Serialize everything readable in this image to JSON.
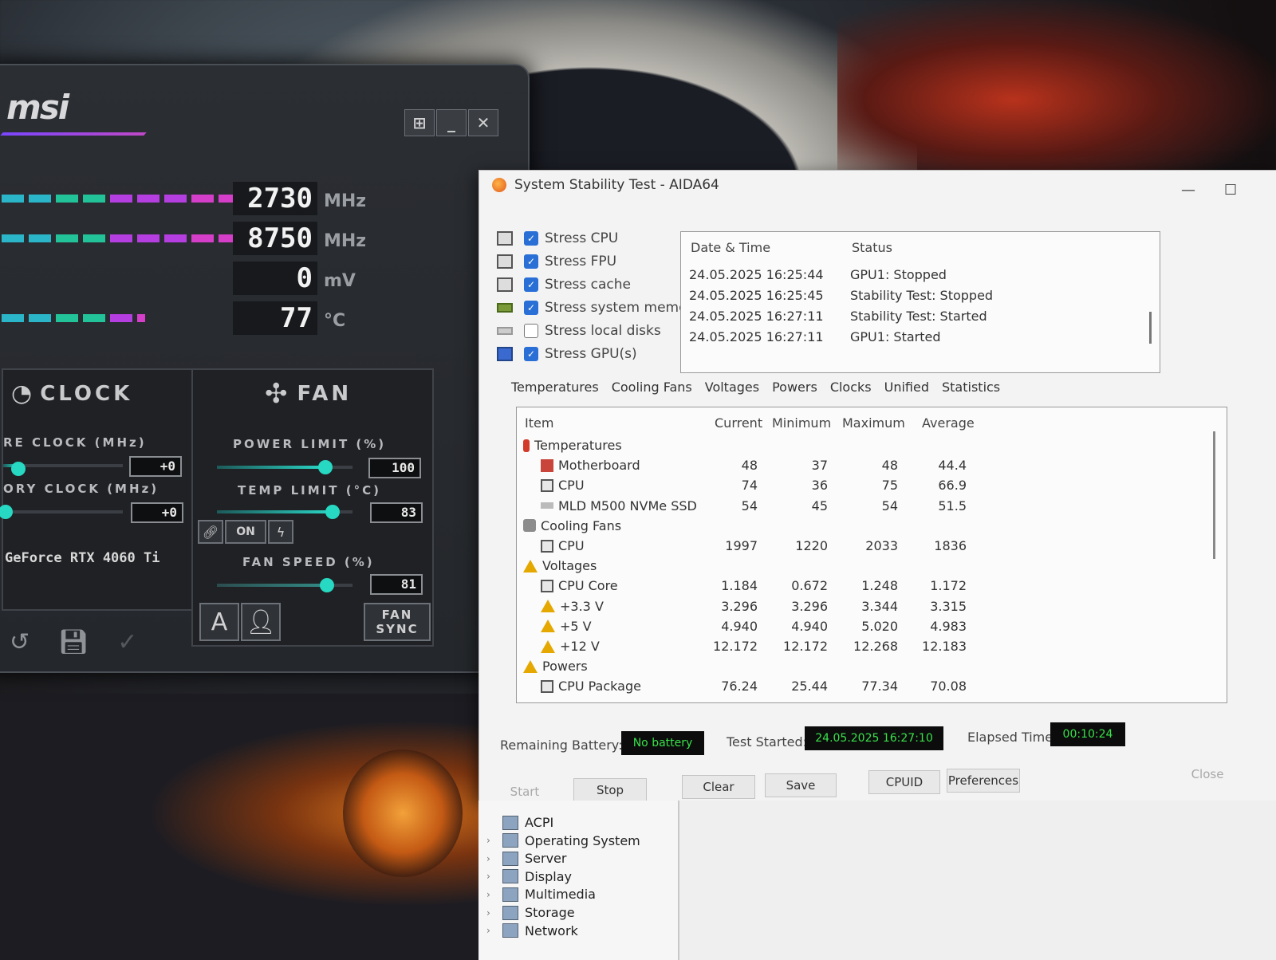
{
  "msi": {
    "logo": "msi",
    "readouts": [
      {
        "value": "2730",
        "unit": "MHz"
      },
      {
        "value": "8750",
        "unit": "MHz"
      },
      {
        "value": "0",
        "unit": "mV"
      },
      {
        "value": "77",
        "unit": "°C"
      }
    ],
    "clock_head": "CLOCK",
    "fan_head": "FAN",
    "core_clock_label": "RE CLOCK (MHz)",
    "core_clock_value": "+0",
    "memory_clock_label": "ORY CLOCK (MHz)",
    "memory_clock_value": "+0",
    "power_limit_label": "POWER LIMIT (%)",
    "power_limit_value": "100",
    "power_limit_level": 0.8,
    "temp_limit_label": "TEMP LIMIT (°C)",
    "temp_limit_value": "83",
    "temp_limit_level": 0.85,
    "link_toggle": "ON",
    "fan_speed_label": "FAN SPEED (%)",
    "fan_speed_value": "81",
    "fan_speed_level": 0.81,
    "gpu_name": "GeForce RTX 4060 Ti",
    "fan_sync": "FAN SYNC",
    "auto_label": "A"
  },
  "aida": {
    "title": "System Stability Test - AIDA64",
    "stress": [
      {
        "label": "Stress CPU",
        "checked": true
      },
      {
        "label": "Stress FPU",
        "checked": true
      },
      {
        "label": "Stress cache",
        "checked": true
      },
      {
        "label": "Stress system memory",
        "checked": true
      },
      {
        "label": "Stress local disks",
        "checked": false
      },
      {
        "label": "Stress GPU(s)",
        "checked": true
      }
    ],
    "log": {
      "col_date": "Date & Time",
      "col_status": "Status",
      "rows": [
        {
          "date": "24.05.2025 16:25:44",
          "status": "GPU1: Stopped"
        },
        {
          "date": "24.05.2025 16:25:45",
          "status": "Stability Test: Stopped"
        },
        {
          "date": "24.05.2025 16:27:11",
          "status": "Stability Test: Started"
        },
        {
          "date": "24.05.2025 16:27:11",
          "status": "GPU1: Started"
        }
      ]
    },
    "tabs": [
      "Temperatures",
      "Cooling Fans",
      "Voltages",
      "Powers",
      "Clocks",
      "Unified",
      "Statistics"
    ],
    "grid": {
      "cols": [
        "Item",
        "Current",
        "Minimum",
        "Maximum",
        "Average"
      ],
      "rows": [
        {
          "name": "Temperatures",
          "icon": "thermometer-icon",
          "group": true
        },
        {
          "name": "Motherboard",
          "icon": "motherboard-icon",
          "cur": "48",
          "min": "37",
          "max": "48",
          "avg": "44.4"
        },
        {
          "name": "CPU",
          "icon": "chip-icon",
          "cur": "74",
          "min": "36",
          "max": "75",
          "avg": "66.9"
        },
        {
          "name": "MLD M500 NVMe SSD",
          "icon": "ssd-icon",
          "cur": "54",
          "min": "45",
          "max": "54",
          "avg": "51.5"
        },
        {
          "name": "Cooling Fans",
          "icon": "fan-icon",
          "group": true
        },
        {
          "name": "CPU",
          "icon": "chip-icon",
          "cur": "1997",
          "min": "1220",
          "max": "2033",
          "avg": "1836"
        },
        {
          "name": "Voltages",
          "icon": "warning-icon",
          "group": true
        },
        {
          "name": "CPU Core",
          "icon": "chip-icon",
          "cur": "1.184",
          "min": "0.672",
          "max": "1.248",
          "avg": "1.172"
        },
        {
          "name": "+3.3 V",
          "icon": "warning-icon",
          "cur": "3.296",
          "min": "3.296",
          "max": "3.344",
          "avg": "3.315"
        },
        {
          "name": "+5 V",
          "icon": "warning-icon",
          "cur": "4.940",
          "min": "4.940",
          "max": "5.020",
          "avg": "4.983"
        },
        {
          "name": "+12 V",
          "icon": "warning-icon",
          "cur": "12.172",
          "min": "12.172",
          "max": "12.268",
          "avg": "12.183"
        },
        {
          "name": "Powers",
          "icon": "warning-icon",
          "group": true
        },
        {
          "name": "CPU Package",
          "icon": "chip-icon",
          "cur": "76.24",
          "min": "25.44",
          "max": "77.34",
          "avg": "70.08"
        }
      ]
    },
    "remaining_battery_label": "Remaining Battery:",
    "remaining_battery_value": "No battery",
    "test_started_label": "Test Started:",
    "test_started_value": "24.05.2025 16:27:10",
    "elapsed_label": "Elapsed Time:",
    "elapsed_value": "00:10:24",
    "buttons": {
      "start": "Start",
      "stop": "Stop",
      "clear": "Clear",
      "save": "Save",
      "cpuid": "CPUID",
      "preferences": "Preferences",
      "close": "Close"
    }
  },
  "tree": {
    "items": [
      {
        "label": "ACPI",
        "expandable": false
      },
      {
        "label": "Operating System",
        "expandable": true
      },
      {
        "label": "Server",
        "expandable": true
      },
      {
        "label": "Display",
        "expandable": true
      },
      {
        "label": "Multimedia",
        "expandable": true
      },
      {
        "label": "Storage",
        "expandable": true
      },
      {
        "label": "Network",
        "expandable": true
      }
    ]
  }
}
